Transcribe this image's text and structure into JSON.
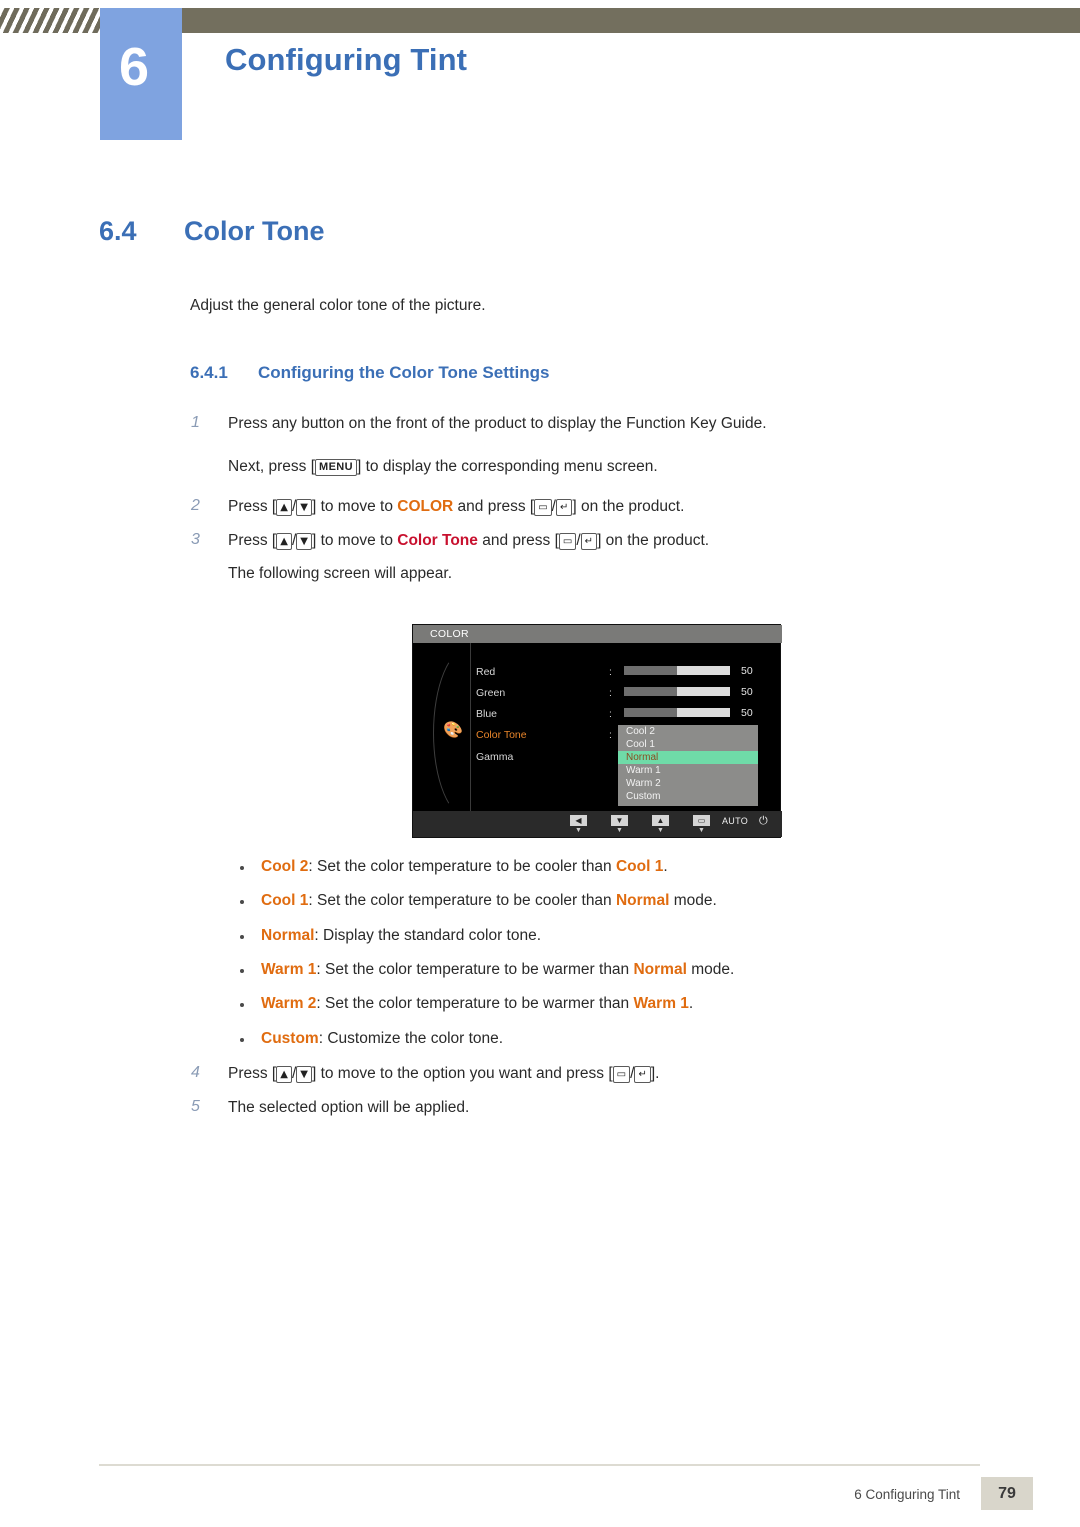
{
  "header": {
    "chapter_number": "6",
    "chapter_title": "Configuring Tint"
  },
  "section": {
    "number": "6.4",
    "title": "Color Tone",
    "intro": "Adjust the general color tone of the picture."
  },
  "subsection": {
    "number": "6.4.1",
    "title": "Configuring the Color Tone Settings"
  },
  "steps": [
    {
      "num": "1",
      "line1_a": "Press any button on the front of the product to display the Function Key Guide.",
      "line2_a": "Next, press [",
      "key": "MENU",
      "line2_b": "] to display the corresponding menu screen."
    },
    {
      "num": "2",
      "a": "Press [",
      "up": "▲",
      "slash": "/",
      "down": "▼",
      "b": "] to move to ",
      "target": "COLOR",
      "c": " and press [",
      "k1": "▭",
      "k2": "↵",
      "d": "] on the product."
    },
    {
      "num": "3",
      "a": "Press [",
      "up": "▲",
      "slash": "/",
      "down": "▼",
      "b": "] to move to ",
      "target": "Color Tone",
      "c": " and press [",
      "k1": "▭",
      "k2": "↵",
      "d": "] on the product.",
      "followup": "The following screen will appear."
    },
    {
      "num": "4",
      "a": "Press [",
      "up": "▲",
      "slash": "/",
      "down": "▼",
      "b": "] to move to the option you want and press [",
      "k1": "▭",
      "k2": "↵",
      "d": "]."
    },
    {
      "num": "5",
      "a": "The selected option will be applied."
    }
  ],
  "osd": {
    "title": "COLOR",
    "icon": "palette-icon",
    "rows": [
      {
        "label": "Red",
        "colon": ":",
        "value": "50"
      },
      {
        "label": "Green",
        "colon": ":",
        "value": "50"
      },
      {
        "label": "Blue",
        "colon": ":",
        "value": "50"
      },
      {
        "label": "Color Tone",
        "colon": ":"
      },
      {
        "label": "Gamma"
      }
    ],
    "menu_items": [
      "Cool 2",
      "Cool 1",
      "Normal",
      "Warm 1",
      "Warm 2",
      "Custom"
    ],
    "menu_selected": "Normal",
    "bottom_buttons": [
      "◀",
      "▼",
      "▲",
      "▭"
    ],
    "bottom_auto": "AUTO",
    "bottom_power": "⏻"
  },
  "bullets": [
    {
      "term": "Cool 2",
      "sep": ": ",
      "text_a": "Set the color temperature to be cooler than ",
      "term2": "Cool 1",
      "text_b": "."
    },
    {
      "term": "Cool 1",
      "sep": ": ",
      "text_a": "Set the color temperature to be cooler than ",
      "term2": "Normal",
      "text_b": " mode."
    },
    {
      "term": "Normal",
      "sep": ": ",
      "text_a": "Display the standard color tone.",
      "term2": "",
      "text_b": ""
    },
    {
      "term": "Warm 1",
      "sep": ": ",
      "text_a": "Set the color temperature to be warmer than ",
      "term2": "Normal",
      "text_b": " mode."
    },
    {
      "term": "Warm 2",
      "sep": ": ",
      "text_a": "Set the color temperature to be warmer than ",
      "term2": "Warm 1",
      "text_b": "."
    },
    {
      "term": "Custom",
      "sep": ": ",
      "text_a": "Customize the color tone.",
      "term2": "",
      "text_b": ""
    }
  ],
  "footer": {
    "text": "6 Configuring Tint",
    "page": "79"
  },
  "colors": {
    "accent_blue": "#3b6fb6",
    "badge_blue": "#7fa3e0",
    "header_bar": "#736f5e",
    "orange": "#e06c10",
    "red": "#c8102e",
    "highlight_green": "#6fdba8"
  }
}
